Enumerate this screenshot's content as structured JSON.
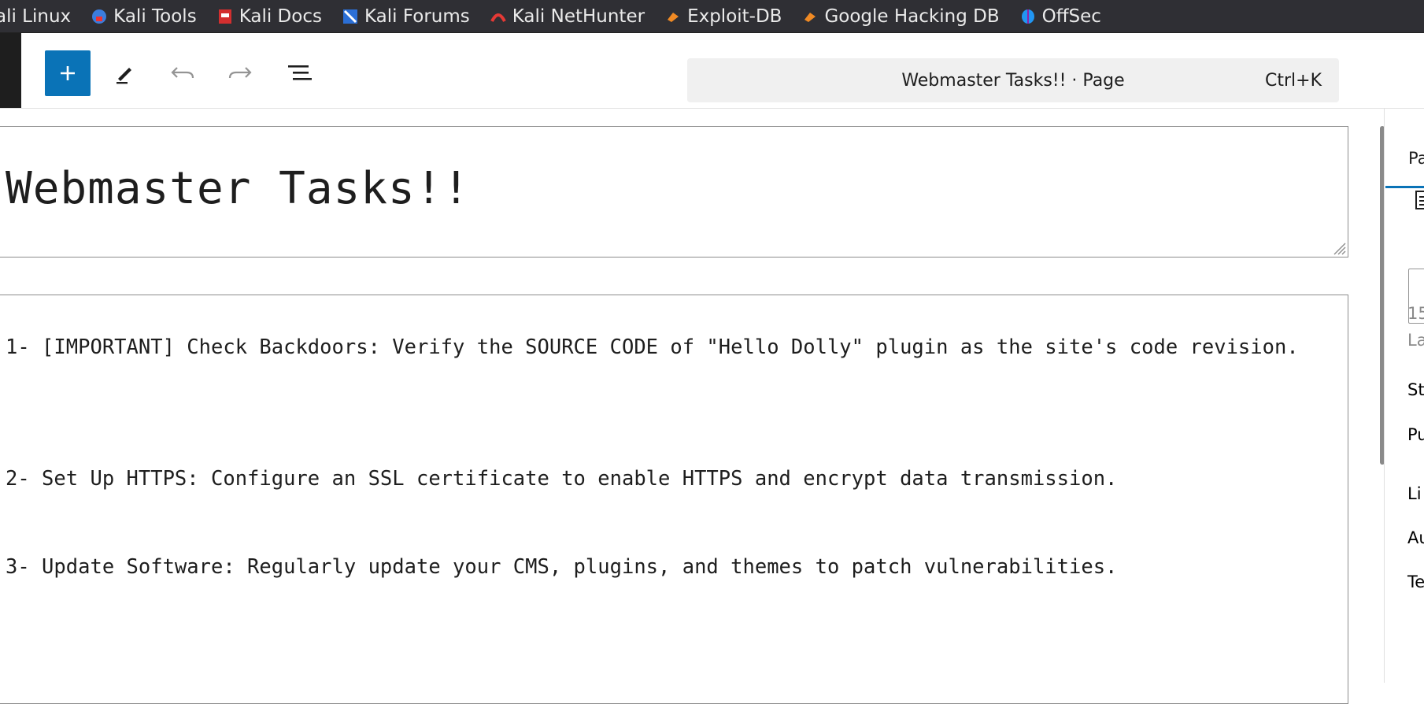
{
  "bookmarks": [
    {
      "label": "ali Linux",
      "icon": "kali-dragon-icon"
    },
    {
      "label": "Kali Tools",
      "icon": "kali-tools-icon"
    },
    {
      "label": "Kali Docs",
      "icon": "kali-docs-icon"
    },
    {
      "label": "Kali Forums",
      "icon": "kali-forums-icon"
    },
    {
      "label": "Kali NetHunter",
      "icon": "kali-nethunter-icon"
    },
    {
      "label": "Exploit-DB",
      "icon": "exploit-db-icon"
    },
    {
      "label": "Google Hacking DB",
      "icon": "ghdb-icon"
    },
    {
      "label": "OffSec",
      "icon": "offsec-icon"
    }
  ],
  "toolbar": {
    "command_title": "Webmaster Tasks!! · Page",
    "command_shortcut": "Ctrl+K",
    "icons": [
      "plus-icon",
      "pencil-icon",
      "undo-icon",
      "redo-icon",
      "list-view-icon"
    ]
  },
  "editor": {
    "title": "Webmaster Tasks!!",
    "tasks": [
      "1- [IMPORTANT] Check Backdoors: Verify the SOURCE CODE of \"Hello Dolly\" plugin as the site's code revision.",
      "2- Set Up HTTPS: Configure an SSL certificate to enable HTTPS and encrypt data transmission.",
      "3- Update Software: Regularly update your CMS, plugins, and themes to patch vulnerabilities."
    ]
  },
  "sidebar": {
    "tab_label": "Pa",
    "line1": "15",
    "line2": "La",
    "status": "St",
    "publish": "Pu",
    "link": "Li",
    "author": "Au",
    "template": "Te"
  },
  "colors": {
    "accent": "#0a73b7",
    "bookmarks_bg": "#2f2f34"
  }
}
